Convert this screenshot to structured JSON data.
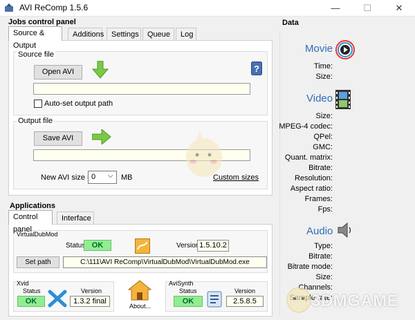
{
  "window": {
    "title": "AVI ReComp  1.5.6",
    "minimize": "—",
    "maximize": "☐",
    "close": "✕"
  },
  "jobs": {
    "title": "Jobs control panel",
    "tabs": [
      "Source & Output",
      "Additions",
      "Settings",
      "Queue",
      "Log"
    ],
    "source": {
      "label": "Source file",
      "open_button": "Open AVI",
      "path": "",
      "auto_set_label": "Auto-set output path"
    },
    "output": {
      "label": "Output file",
      "save_button": "Save AVI",
      "path": "",
      "size_label": "New AVI size =",
      "size_value": "0",
      "size_unit": "MB",
      "custom_sizes": "Custom sizes"
    }
  },
  "applications": {
    "title": "Applications",
    "tabs": [
      "Control panel",
      "Interface"
    ],
    "virtualdub": {
      "label": "VirtualDubMod",
      "status_label": "Status",
      "status": "OK",
      "version_label": "Version",
      "version": "1.5.10.2",
      "set_path_button": "Set path",
      "path": "C:\\111\\AVI ReComp\\VirtualDubMod\\VirtualDubMod.exe"
    },
    "xvid": {
      "label": "Xvid",
      "status_label": "Status",
      "status": "OK",
      "version_label": "Version",
      "version": "1.3.2 final"
    },
    "about": "About...",
    "avisynth": {
      "label": "AviSynth",
      "status_label": "Status",
      "status": "OK",
      "version_label": "Version",
      "version": "2.5.8.5"
    }
  },
  "data": {
    "title": "Data",
    "movie": {
      "heading": "Movie",
      "fields": [
        "Time:",
        "Size:"
      ]
    },
    "video": {
      "heading": "Video",
      "fields": [
        "Size:",
        "MPEG-4 codec:",
        "QPel:",
        "GMC:",
        "Quant. matrix:",
        "Bitrate:",
        "Resolution:",
        "Aspect ratio:",
        "Frames:",
        "Fps:"
      ]
    },
    "audio": {
      "heading": "Audio",
      "fields": [
        "Type:",
        "Bitrate:",
        "Bitrate mode:",
        "Size:",
        "Channels:",
        "Sample rate:"
      ]
    }
  },
  "watermark": "3DMGAME",
  "colors": {
    "accent_blue": "#2f6db5",
    "ok_green": "#90ee90",
    "field_bg": "#fffff0",
    "arrow_green": "#7ac943"
  }
}
